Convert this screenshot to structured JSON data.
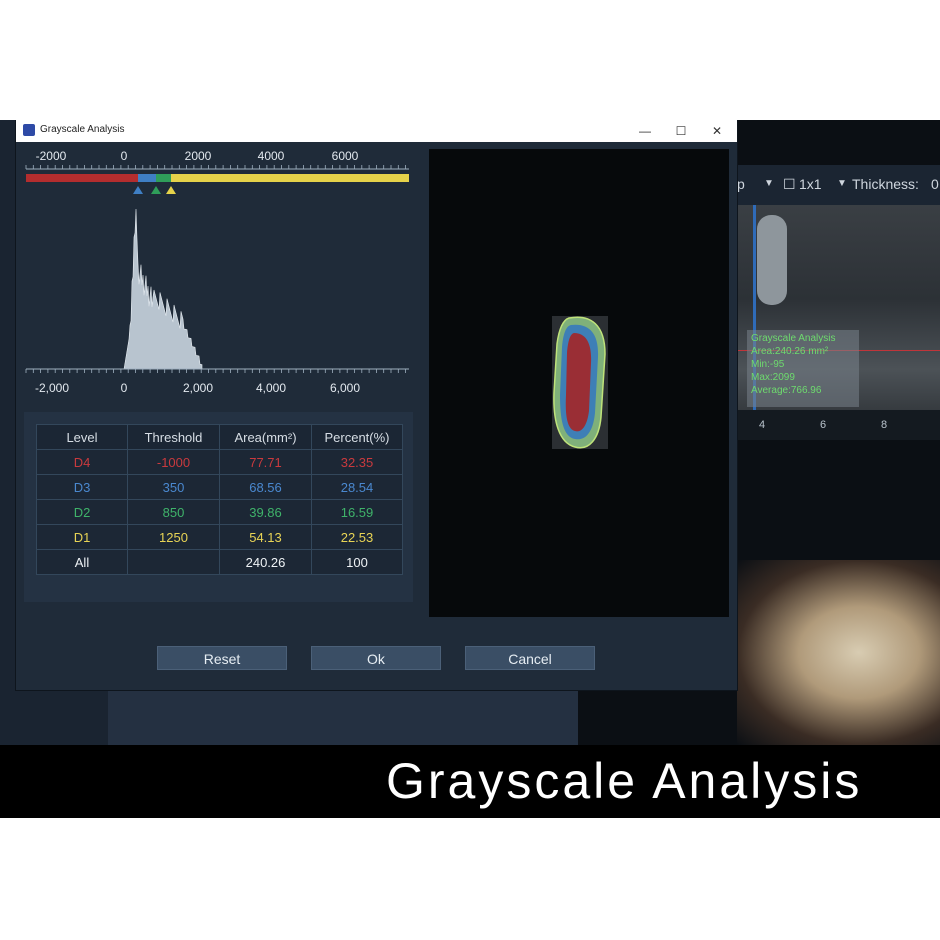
{
  "window": {
    "title": "Grayscale Analysis",
    "minimize_label": "—",
    "maximize_label": "☐",
    "close_label": "✕"
  },
  "background": {
    "toolbar": {
      "p_label": "p",
      "layout_label": "1x1",
      "thickness_label": "Thickness:",
      "thickness_value": "0"
    },
    "ct_info": {
      "title": "Grayscale Analysis",
      "lines": [
        "Area:240.26 mm²",
        "Min:-95",
        "Max:2099",
        "Average:766.96"
      ]
    },
    "ruler_labels": [
      "4",
      "6",
      "8"
    ]
  },
  "threshold_bar": {
    "ticks": [
      "-2000",
      "0",
      "2000",
      "4000",
      "6000"
    ],
    "colors": {
      "d4": "#b32d2e",
      "d3": "#3f7fc4",
      "d2": "#2f9e5a",
      "d1": "#e5d24a"
    }
  },
  "histogram": {
    "x_ticks": [
      "-2,000",
      "0",
      "2,000",
      "4,000",
      "6,000"
    ],
    "fill_color": "#b8c4cf"
  },
  "table": {
    "headers": [
      "Level",
      "Threshold",
      "Area(mm²)",
      "Percent(%)"
    ],
    "rows": [
      {
        "level": "D4",
        "threshold": "-1000",
        "area": "77.71",
        "percent": "32.35",
        "color": "#c93a3e"
      },
      {
        "level": "D3",
        "threshold": "350",
        "area": "68.56",
        "percent": "28.54",
        "color": "#4a88cf"
      },
      {
        "level": "D2",
        "threshold": "850",
        "area": "39.86",
        "percent": "16.59",
        "color": "#3fb36a"
      },
      {
        "level": "D1",
        "threshold": "1250",
        "area": "54.13",
        "percent": "22.53",
        "color": "#e8d455"
      },
      {
        "level": "All",
        "threshold": "",
        "area": "240.26",
        "percent": "100",
        "color": "#eef2f5"
      }
    ]
  },
  "buttons": {
    "reset": "Reset",
    "ok": "Ok",
    "cancel": "Cancel"
  },
  "caption": "Grayscale Analysis"
}
